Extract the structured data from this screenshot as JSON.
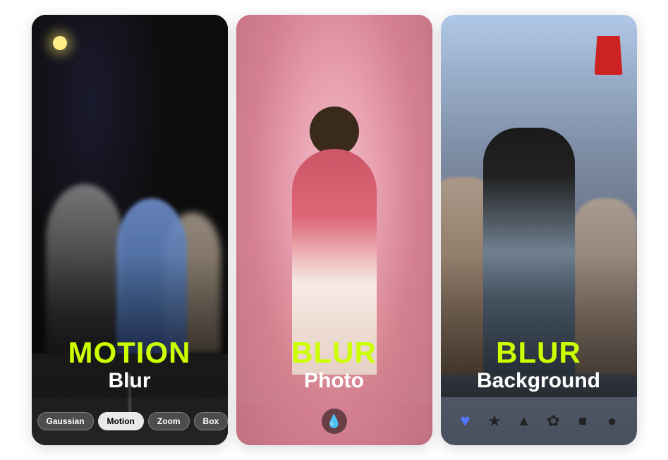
{
  "cards": [
    {
      "id": "card-motion-blur",
      "title_green": "MOTION",
      "title_white": "Blur",
      "controls": {
        "type": "pills",
        "items": [
          {
            "label": "Gaussian",
            "active": false
          },
          {
            "label": "Motion",
            "active": true
          },
          {
            "label": "Zoom",
            "active": false
          },
          {
            "label": "Box",
            "active": false
          }
        ]
      }
    },
    {
      "id": "card-blur-photo",
      "title_green": "BLUR",
      "title_white": "Photo",
      "controls": {
        "type": "icon",
        "icon": "💧"
      }
    },
    {
      "id": "card-blur-background",
      "title_green": "BLUR",
      "title_white": "Background",
      "controls": {
        "type": "shapes",
        "items": [
          "♥",
          "★",
          "▲",
          "✿",
          "■",
          "●"
        ]
      }
    }
  ]
}
